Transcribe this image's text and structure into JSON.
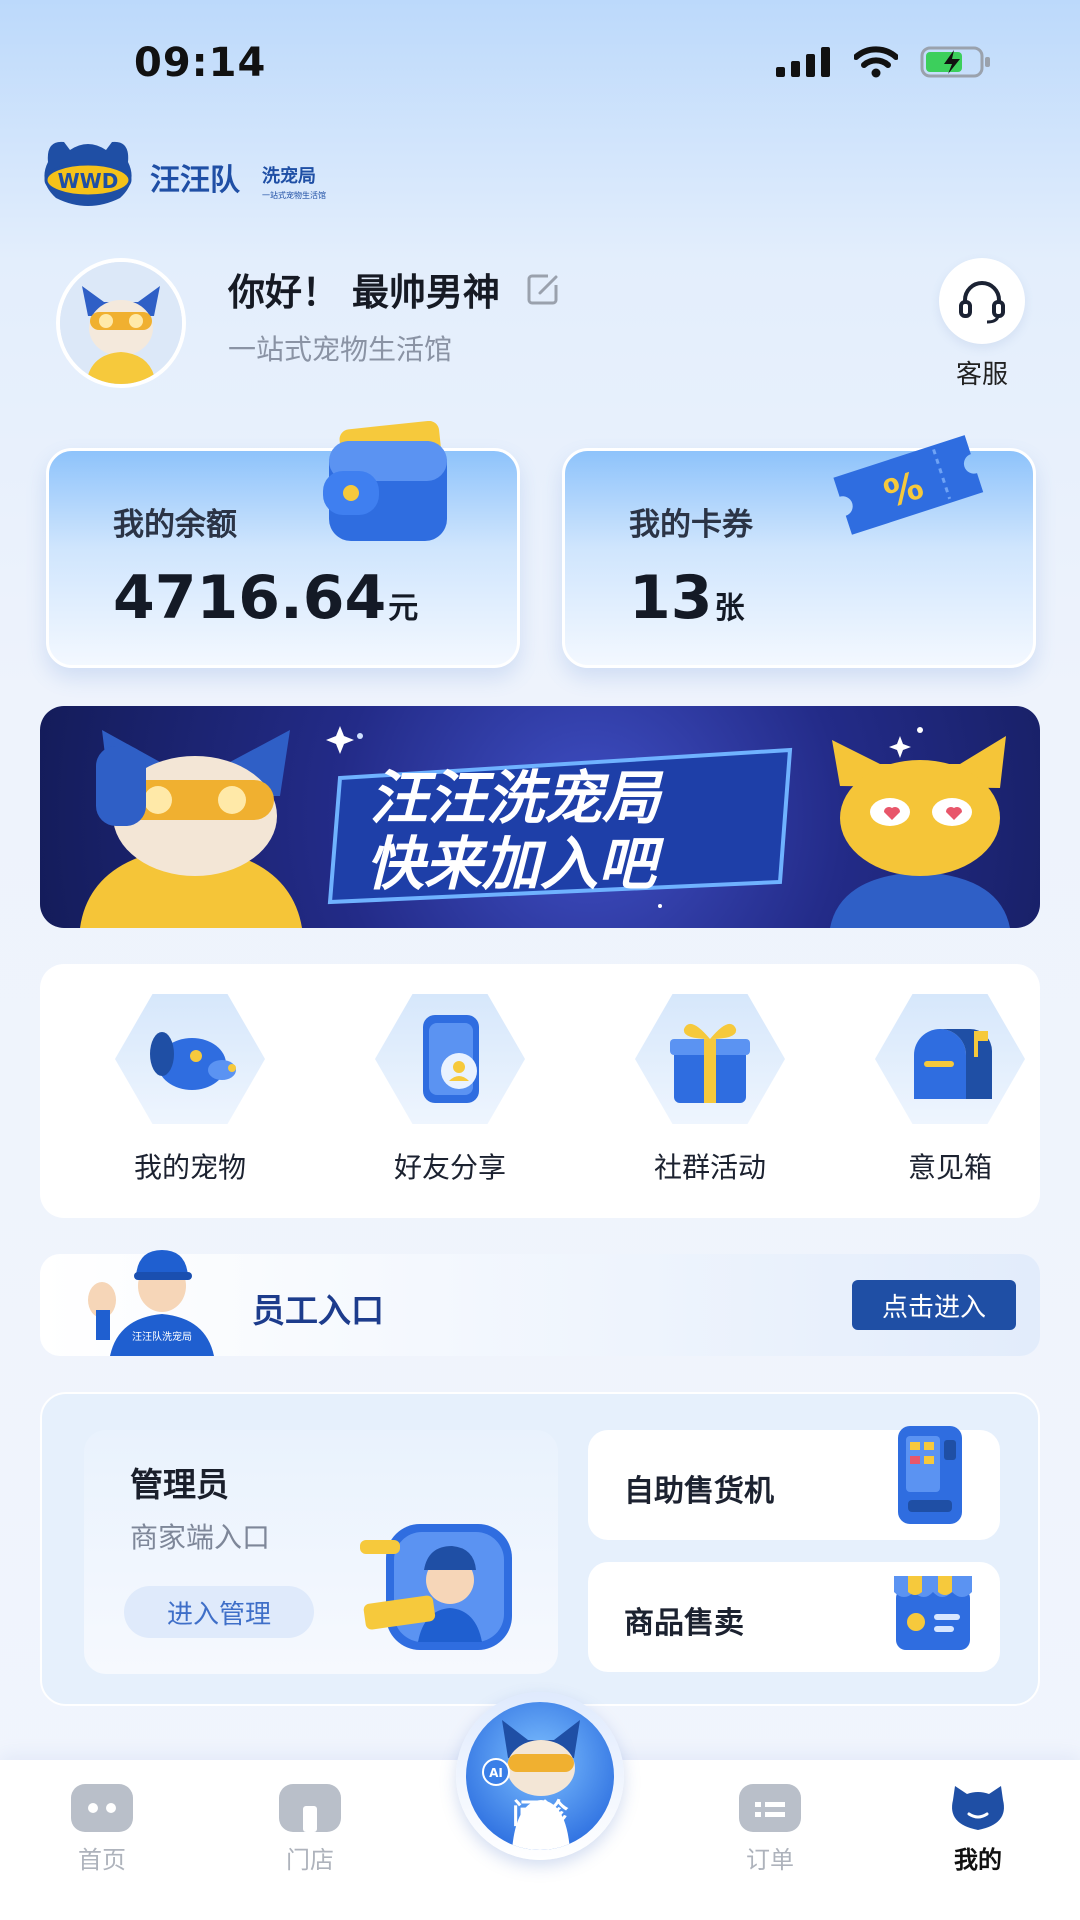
{
  "status_bar": {
    "time": "09:14"
  },
  "brand": {
    "logo_mark": "WWD",
    "name": "汪汪队",
    "sub_name": "洗宠局",
    "tagline": "一站式宠物生活馆"
  },
  "profile": {
    "greeting": "你好！ 最帅男神",
    "subtitle": "一站式宠物生活馆"
  },
  "service": {
    "label": "客服"
  },
  "balance_card": {
    "title": "我的余额",
    "value": "4716.64",
    "unit": "元"
  },
  "coupon_card": {
    "title": "我的卡券",
    "value": "13",
    "unit": "张"
  },
  "banner": {
    "line1": "汪汪洗宠局",
    "line2": "快来加入吧"
  },
  "features": [
    {
      "label": "我的宠物",
      "icon": "dog-icon"
    },
    {
      "label": "好友分享",
      "icon": "phone-share-icon"
    },
    {
      "label": "社群活动",
      "icon": "gift-icon"
    },
    {
      "label": "意见箱",
      "icon": "mailbox-icon"
    }
  ],
  "staff": {
    "label": "员工入口",
    "button": "点击进入",
    "badge": "汪汪队洗宠局"
  },
  "admin": {
    "title": "管理员",
    "subtitle": "商家端入口",
    "button": "进入管理",
    "vending": "自助售货机",
    "goods": "商品售卖"
  },
  "tabbar": {
    "home": "首页",
    "store": "门店",
    "consult": "问诊",
    "consult_badge": "AI",
    "orders": "订单",
    "mine": "我的"
  },
  "colors": {
    "accent": "#1f4fa5",
    "brand_blue": "#2d6fe0",
    "brand_yellow": "#f6c344"
  }
}
